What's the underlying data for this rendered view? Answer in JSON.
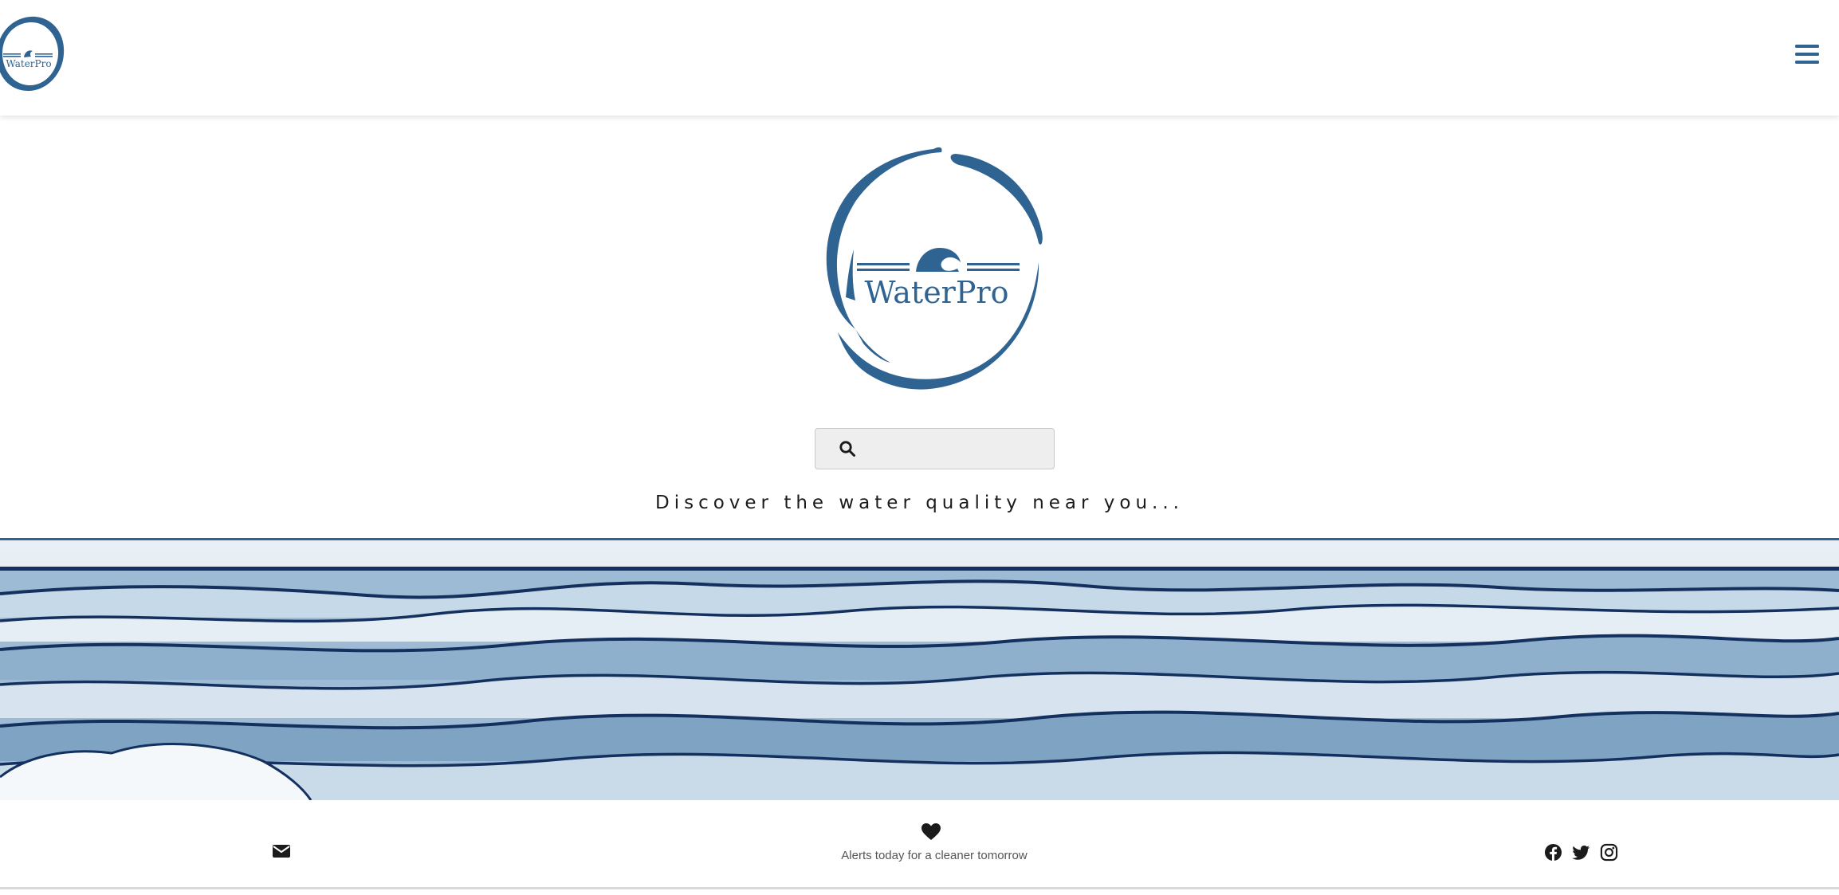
{
  "header": {
    "logo_text": "WaterPro",
    "menu_icon": "hamburger-menu-icon"
  },
  "hero": {
    "logo_text": "WaterPro",
    "search": {
      "icon": "search-icon",
      "placeholder": "",
      "value": ""
    },
    "tagline": "Discover the water quality near you..."
  },
  "footer": {
    "contact_icon": "envelope-icon",
    "heart_icon": "heart-icon",
    "slogan": "Alerts today for a cleaner tomorrow",
    "social_icons": [
      "facebook-icon",
      "twitter-icon",
      "instagram-icon"
    ]
  },
  "colors": {
    "brand_blue": "#2f6391",
    "wave_light": "#a9c4da",
    "wave_dark": "#13305e",
    "text": "#1b1b1b",
    "muted_text": "#555555",
    "search_bg": "#eeeeee"
  }
}
